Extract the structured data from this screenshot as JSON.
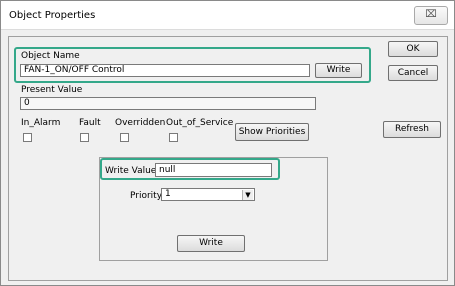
{
  "window": {
    "title": "Object Properties",
    "close_glyph": "⌧"
  },
  "object_name": {
    "label": "Object Name",
    "value": "FAN-1_ON/OFF Control",
    "write_label": "Write"
  },
  "present_value": {
    "label": "Present Value",
    "value": "0"
  },
  "flags": [
    {
      "label": "In_Alarm",
      "checked": false
    },
    {
      "label": "Fault",
      "checked": false
    },
    {
      "label": "Overridden",
      "checked": false
    },
    {
      "label": "Out_of_Service",
      "checked": false
    }
  ],
  "buttons": {
    "ok": "OK",
    "cancel": "Cancel",
    "refresh": "Refresh",
    "show_priorities": "Show Priorities"
  },
  "write_panel": {
    "write_value_label": "Write Value",
    "write_value": "null",
    "priority_label": "Priority",
    "priority_selected": "1",
    "write_label": "Write"
  },
  "colors": {
    "highlight": "#34a88a"
  }
}
